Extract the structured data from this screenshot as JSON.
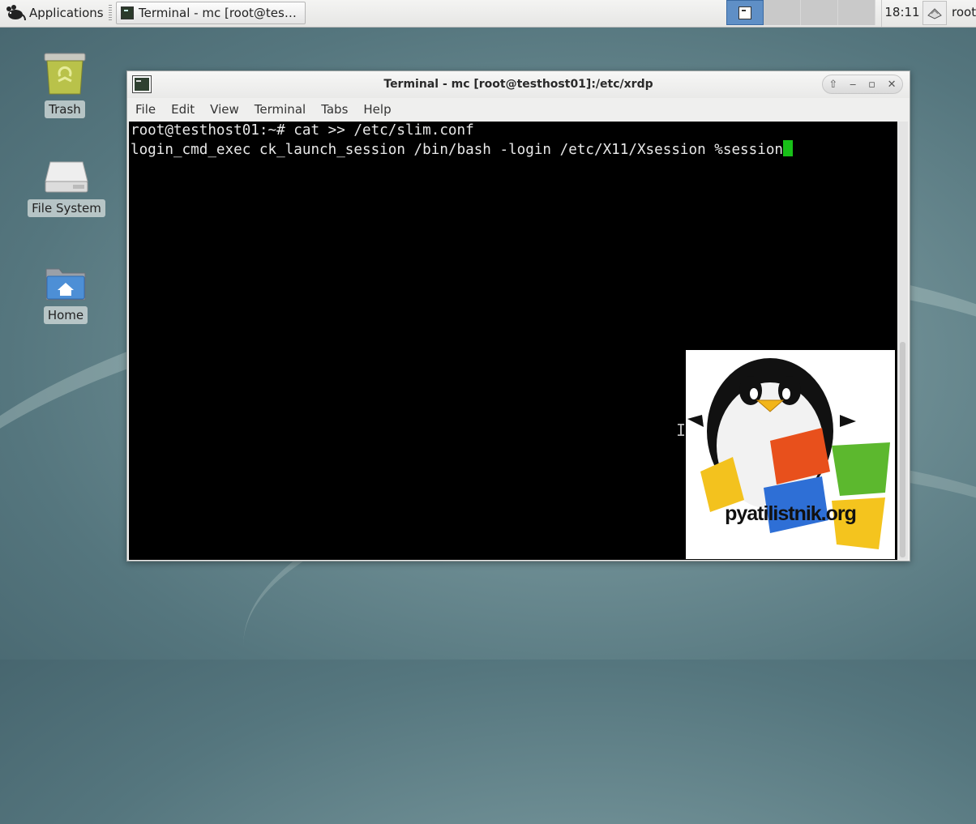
{
  "panel": {
    "applications_label": "Applications",
    "task_label": "Terminal - mc [root@tes…",
    "clock": "18:11",
    "user": "root"
  },
  "desktop_icons": [
    {
      "label": "Trash",
      "icon": "trash-icon"
    },
    {
      "label": "File System",
      "icon": "drive-icon"
    },
    {
      "label": "Home",
      "icon": "home-folder-icon"
    }
  ],
  "window": {
    "title": "Terminal - mc [root@testhost01]:/etc/xrdp",
    "menu": [
      "File",
      "Edit",
      "View",
      "Terminal",
      "Tabs",
      "Help"
    ]
  },
  "terminal": {
    "lines": [
      "root@testhost01:~# cat >> /etc/slim.conf",
      "login_cmd_exec ck_launch_session /bin/bash -login /etc/X11/Xsession %session"
    ]
  },
  "watermark": {
    "text": "pyatilistnik.org"
  },
  "colors": {
    "cursor": "#18c018",
    "active_workspace": "#5f8fc6",
    "terminal_bg": "#000000"
  }
}
